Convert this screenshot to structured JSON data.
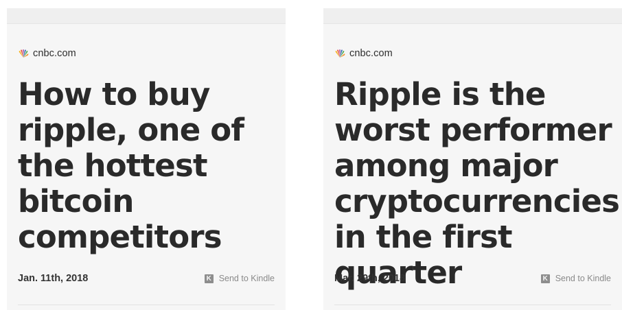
{
  "cards": [
    {
      "source": "cnbc.com",
      "headline_lines": [
        "How to buy",
        "ripple, one of",
        "the hottest",
        "bitcoin",
        "competitors"
      ],
      "date": "Jan. 11th, 2018",
      "kindle_label": "Send to Kindle",
      "kindle_icon": "K"
    },
    {
      "source": "cnbc.com",
      "headline_lines": [
        "Ripple is the",
        "worst performer",
        "among major",
        "cryptocurrencies",
        "in the first quarter"
      ],
      "date": "Mar. 29th, 2018",
      "kindle_label": "Send to Kindle",
      "kindle_icon": "K"
    }
  ],
  "colors": {
    "peacock": [
      "#f7b21b",
      "#e8503a",
      "#b25ba8",
      "#2e6db4",
      "#4ea94b",
      "#f38d2a"
    ]
  }
}
